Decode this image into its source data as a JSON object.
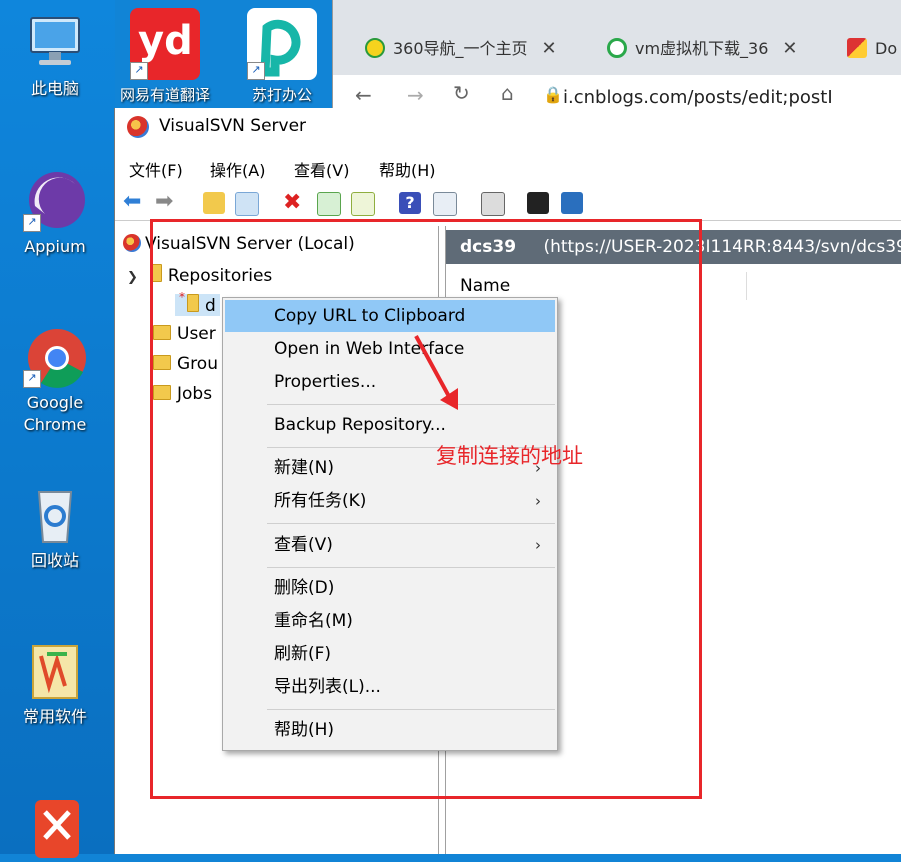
{
  "desktop": {
    "top_icons": [
      {
        "label": "网易有道翻译",
        "icon": "youdao-icon",
        "text": "yd"
      },
      {
        "label": "苏打办公",
        "icon": "suda-office-icon"
      }
    ],
    "icons": [
      {
        "label": "此电脑",
        "icon": "computer-icon"
      },
      {
        "label": "Appium",
        "icon": "appium-icon"
      },
      {
        "label": "Google Chrome",
        "label_line1": "Google",
        "label_line2": "Chrome",
        "icon": "chrome-icon"
      },
      {
        "label": "回收站",
        "icon": "recycle-bin-icon"
      },
      {
        "label": "常用软件",
        "icon": "folder-icon"
      }
    ]
  },
  "browser": {
    "tabs": [
      {
        "title": "360导航_一个主页",
        "icon": "360-icon"
      },
      {
        "title": "vm虚拟机下载_36",
        "icon": "search-icon"
      },
      {
        "title": "Do",
        "icon": "app-icon"
      }
    ],
    "close_glyph": "✕",
    "url": "i.cnblogs.com/posts/edit;postI"
  },
  "window": {
    "title": "VisualSVN Server",
    "menus": [
      "文件(F)",
      "操作(A)",
      "查看(V)",
      "帮助(H)"
    ],
    "tree": {
      "root": "VisualSVN Server (Local)",
      "repositories": "Repositories",
      "repo_item": "d",
      "users": "User",
      "groups": "Grou",
      "jobs": "Jobs"
    },
    "right_pane": {
      "header_name": "dcs39",
      "header_url": "(https://USER-2023I114RR:8443/svn/dcs39",
      "column_name": "Name"
    }
  },
  "context_menu": {
    "items": [
      {
        "label": "Copy URL to Clipboard",
        "highlighted": true
      },
      {
        "label": "Open in Web Interface"
      },
      {
        "label": "Properties..."
      },
      {
        "label": "Backup Repository..."
      },
      {
        "label": "新建(N)",
        "submenu": true
      },
      {
        "label": "所有任务(K)",
        "submenu": true
      },
      {
        "label": "查看(V)",
        "submenu": true
      },
      {
        "label": "删除(D)"
      },
      {
        "label": "重命名(M)"
      },
      {
        "label": "刷新(F)"
      },
      {
        "label": "导出列表(L)..."
      },
      {
        "label": "帮助(H)"
      }
    ],
    "arrow_glyph": "›"
  },
  "annotation": {
    "text": "复制连接的地址",
    "color": "#e8262a"
  },
  "colors": {
    "desktop": "#1184d6",
    "highlight": "#90c8f6",
    "header_bar": "#5f6b77"
  }
}
